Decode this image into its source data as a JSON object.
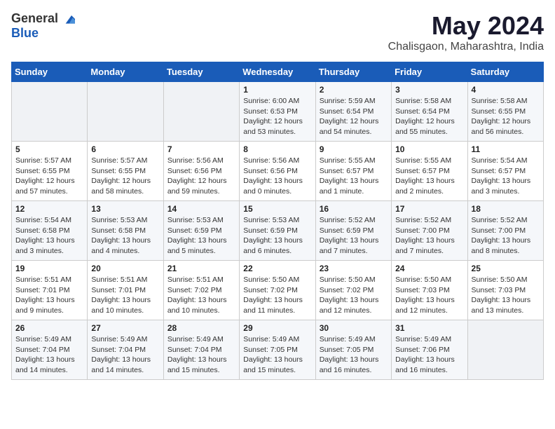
{
  "header": {
    "logo_general": "General",
    "logo_blue": "Blue",
    "month_year": "May 2024",
    "location": "Chalisgaon, Maharashtra, India"
  },
  "days_of_week": [
    "Sunday",
    "Monday",
    "Tuesday",
    "Wednesday",
    "Thursday",
    "Friday",
    "Saturday"
  ],
  "weeks": [
    [
      {
        "day": "",
        "content": ""
      },
      {
        "day": "",
        "content": ""
      },
      {
        "day": "",
        "content": ""
      },
      {
        "day": "1",
        "content": "Sunrise: 6:00 AM\nSunset: 6:53 PM\nDaylight: 12 hours\nand 53 minutes."
      },
      {
        "day": "2",
        "content": "Sunrise: 5:59 AM\nSunset: 6:54 PM\nDaylight: 12 hours\nand 54 minutes."
      },
      {
        "day": "3",
        "content": "Sunrise: 5:58 AM\nSunset: 6:54 PM\nDaylight: 12 hours\nand 55 minutes."
      },
      {
        "day": "4",
        "content": "Sunrise: 5:58 AM\nSunset: 6:55 PM\nDaylight: 12 hours\nand 56 minutes."
      }
    ],
    [
      {
        "day": "5",
        "content": "Sunrise: 5:57 AM\nSunset: 6:55 PM\nDaylight: 12 hours\nand 57 minutes."
      },
      {
        "day": "6",
        "content": "Sunrise: 5:57 AM\nSunset: 6:55 PM\nDaylight: 12 hours\nand 58 minutes."
      },
      {
        "day": "7",
        "content": "Sunrise: 5:56 AM\nSunset: 6:56 PM\nDaylight: 12 hours\nand 59 minutes."
      },
      {
        "day": "8",
        "content": "Sunrise: 5:56 AM\nSunset: 6:56 PM\nDaylight: 13 hours\nand 0 minutes."
      },
      {
        "day": "9",
        "content": "Sunrise: 5:55 AM\nSunset: 6:57 PM\nDaylight: 13 hours\nand 1 minute."
      },
      {
        "day": "10",
        "content": "Sunrise: 5:55 AM\nSunset: 6:57 PM\nDaylight: 13 hours\nand 2 minutes."
      },
      {
        "day": "11",
        "content": "Sunrise: 5:54 AM\nSunset: 6:57 PM\nDaylight: 13 hours\nand 3 minutes."
      }
    ],
    [
      {
        "day": "12",
        "content": "Sunrise: 5:54 AM\nSunset: 6:58 PM\nDaylight: 13 hours\nand 3 minutes."
      },
      {
        "day": "13",
        "content": "Sunrise: 5:53 AM\nSunset: 6:58 PM\nDaylight: 13 hours\nand 4 minutes."
      },
      {
        "day": "14",
        "content": "Sunrise: 5:53 AM\nSunset: 6:59 PM\nDaylight: 13 hours\nand 5 minutes."
      },
      {
        "day": "15",
        "content": "Sunrise: 5:53 AM\nSunset: 6:59 PM\nDaylight: 13 hours\nand 6 minutes."
      },
      {
        "day": "16",
        "content": "Sunrise: 5:52 AM\nSunset: 6:59 PM\nDaylight: 13 hours\nand 7 minutes."
      },
      {
        "day": "17",
        "content": "Sunrise: 5:52 AM\nSunset: 7:00 PM\nDaylight: 13 hours\nand 7 minutes."
      },
      {
        "day": "18",
        "content": "Sunrise: 5:52 AM\nSunset: 7:00 PM\nDaylight: 13 hours\nand 8 minutes."
      }
    ],
    [
      {
        "day": "19",
        "content": "Sunrise: 5:51 AM\nSunset: 7:01 PM\nDaylight: 13 hours\nand 9 minutes."
      },
      {
        "day": "20",
        "content": "Sunrise: 5:51 AM\nSunset: 7:01 PM\nDaylight: 13 hours\nand 10 minutes."
      },
      {
        "day": "21",
        "content": "Sunrise: 5:51 AM\nSunset: 7:02 PM\nDaylight: 13 hours\nand 10 minutes."
      },
      {
        "day": "22",
        "content": "Sunrise: 5:50 AM\nSunset: 7:02 PM\nDaylight: 13 hours\nand 11 minutes."
      },
      {
        "day": "23",
        "content": "Sunrise: 5:50 AM\nSunset: 7:02 PM\nDaylight: 13 hours\nand 12 minutes."
      },
      {
        "day": "24",
        "content": "Sunrise: 5:50 AM\nSunset: 7:03 PM\nDaylight: 13 hours\nand 12 minutes."
      },
      {
        "day": "25",
        "content": "Sunrise: 5:50 AM\nSunset: 7:03 PM\nDaylight: 13 hours\nand 13 minutes."
      }
    ],
    [
      {
        "day": "26",
        "content": "Sunrise: 5:49 AM\nSunset: 7:04 PM\nDaylight: 13 hours\nand 14 minutes."
      },
      {
        "day": "27",
        "content": "Sunrise: 5:49 AM\nSunset: 7:04 PM\nDaylight: 13 hours\nand 14 minutes."
      },
      {
        "day": "28",
        "content": "Sunrise: 5:49 AM\nSunset: 7:04 PM\nDaylight: 13 hours\nand 15 minutes."
      },
      {
        "day": "29",
        "content": "Sunrise: 5:49 AM\nSunset: 7:05 PM\nDaylight: 13 hours\nand 15 minutes."
      },
      {
        "day": "30",
        "content": "Sunrise: 5:49 AM\nSunset: 7:05 PM\nDaylight: 13 hours\nand 16 minutes."
      },
      {
        "day": "31",
        "content": "Sunrise: 5:49 AM\nSunset: 7:06 PM\nDaylight: 13 hours\nand 16 minutes."
      },
      {
        "day": "",
        "content": ""
      }
    ]
  ]
}
